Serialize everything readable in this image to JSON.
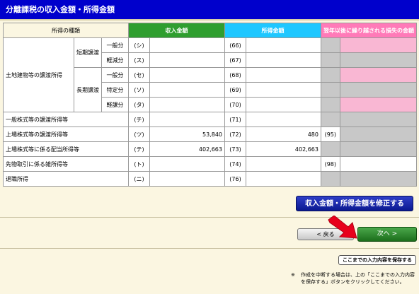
{
  "title": "分離課税の収入金額・所得金額",
  "headers": {
    "kind": "所得の種類",
    "income": "収入金額",
    "shotoku": "所得金額",
    "loss": "翌年以後に繰り越される損失の金額"
  },
  "land": {
    "group": "土地建物等の譲渡所得",
    "short": "短期譲渡",
    "long": "長期譲渡",
    "general": "一般分",
    "reduced": "軽減分",
    "specific": "特定分",
    "light": "軽課分"
  },
  "rows": {
    "r1": {
      "code": "(シ)",
      "code2": "(66)",
      "income": "",
      "shotoku": ""
    },
    "r2": {
      "code": "(ス)",
      "code2": "(67)",
      "income": "",
      "shotoku": ""
    },
    "r3": {
      "code": "(セ)",
      "code2": "(68)",
      "income": "",
      "shotoku": ""
    },
    "r4": {
      "code": "(ソ)",
      "code2": "(69)",
      "income": "",
      "shotoku": ""
    },
    "r5": {
      "code": "(タ)",
      "code2": "(70)",
      "income": "",
      "shotoku": ""
    },
    "r6": {
      "label": "一般株式等の譲渡所得等",
      "code": "(チ)",
      "code2": "(71)",
      "income": "",
      "shotoku": ""
    },
    "r7": {
      "label": "上場株式等の譲渡所得等",
      "code": "(ツ)",
      "code2": "(72)",
      "income": "53,840",
      "shotoku": "480",
      "code3": "(95)"
    },
    "r8": {
      "label": "上場株式等に係る配当所得等",
      "code": "(テ)",
      "code2": "(73)",
      "income": "402,663",
      "shotoku": "402,663"
    },
    "r9": {
      "label": "先物取引に係る雑所得等",
      "code": "(ト)",
      "code2": "(74)",
      "income": "",
      "shotoku": "",
      "code3": "(98)"
    },
    "r10": {
      "label": "退職所得",
      "code": "(ニ)",
      "code2": "(76)",
      "income": "",
      "shotoku": ""
    }
  },
  "buttons": {
    "fix": "収入金額・所得金額を修正する",
    "back": "< 戻る",
    "next": "次へ >",
    "save": "ここまでの入力内容を保存する"
  },
  "note": {
    "mark": "※",
    "text": "作成を中断する場合は、上の「ここまでの入力内容を保存する」ボタンをクリックしてください。"
  },
  "colors": {
    "title_bg": "#0000cc",
    "income_header": "#2f9e2f",
    "shotoku_header": "#1ec7ff",
    "loss_header": "#ff7ab8",
    "arrow": "#e8001c"
  }
}
